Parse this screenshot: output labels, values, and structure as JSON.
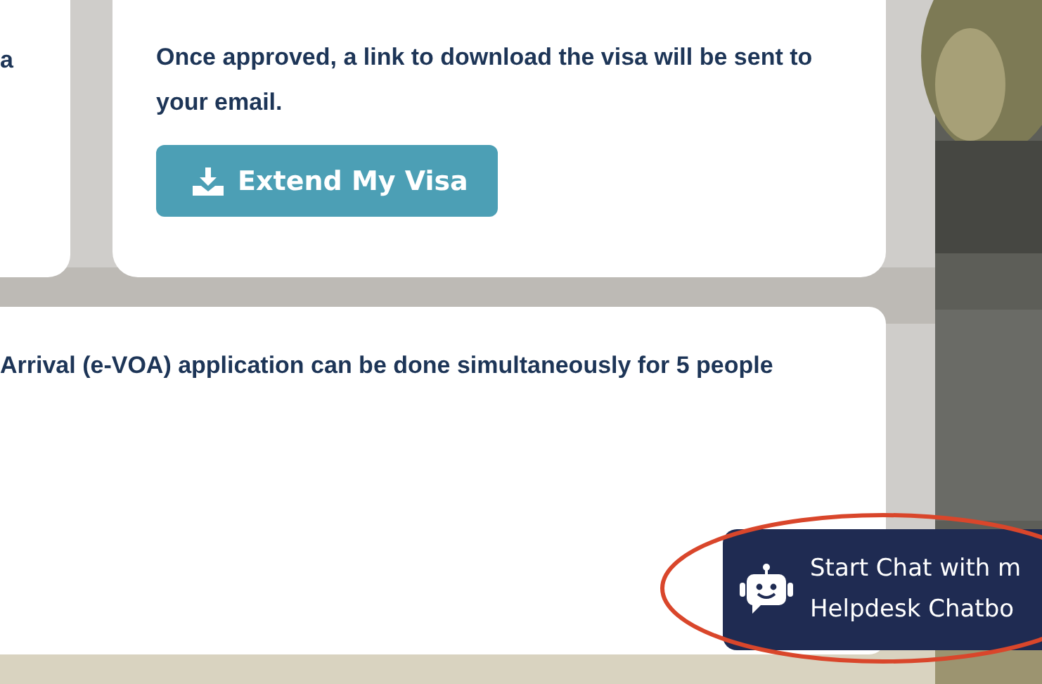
{
  "left_card": {
    "text": "a"
  },
  "approval_card": {
    "text": "Once approved, a link to download the visa will be sent to your email.",
    "button": "Extend My Visa"
  },
  "info_card": {
    "text": "Arrival (e-VOA) application can be done simultaneously for 5 people"
  },
  "chatbot": {
    "lines": [
      "Start Chat with m",
      "Helpdesk Chatbo"
    ]
  }
}
